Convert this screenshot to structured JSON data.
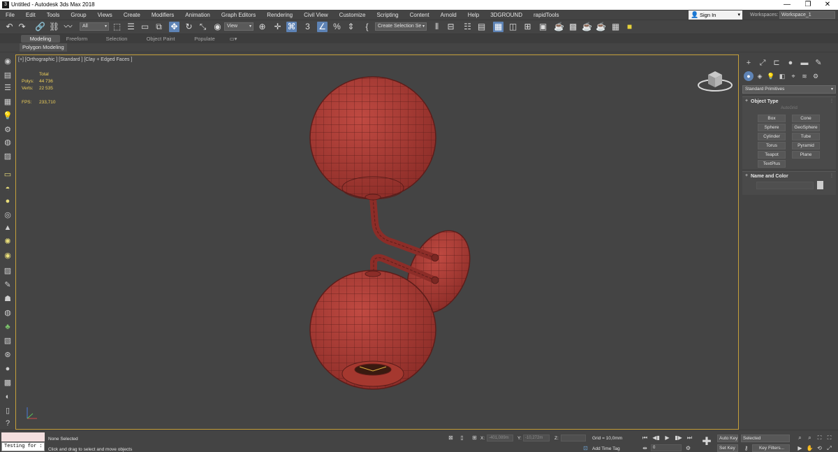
{
  "window": {
    "title": "Untitled - Autodesk 3ds Max 2018",
    "app_icon": "3ds-max-logo-icon",
    "minimize": "—",
    "restore": "❐",
    "close": "✕"
  },
  "menu": {
    "items": [
      "File",
      "Edit",
      "Tools",
      "Group",
      "Views",
      "Create",
      "Modifiers",
      "Animation",
      "Graph Editors",
      "Rendering",
      "Civil View",
      "Customize",
      "Scripting",
      "Content",
      "Arnold",
      "Help",
      "3DGROUND",
      "rapidTools"
    ],
    "sign_in": "Sign In",
    "workspaces_label": "Workspaces:",
    "workspace_value": "Workspace_1"
  },
  "toolbar": {
    "selection_filter": "All",
    "reference_coord": "View",
    "named_selection_set": "Create Selection Se"
  },
  "ribbon": {
    "tabs": [
      "Modeling",
      "Freeform",
      "Selection",
      "Object Paint",
      "Populate"
    ],
    "sub_tab": "Polygon Modeling"
  },
  "viewport": {
    "label": "[+] [Orthographic ] [Standard ] [Clay + Edged Faces ]",
    "stats": {
      "total_label": "Total",
      "polys_label": "Polys:",
      "polys_value": "44 736",
      "verts_label": "Verts:",
      "verts_value": "22 535",
      "fps_label": "FPS:",
      "fps_value": "233,710"
    },
    "model_color": "#a93a33",
    "wire_color": "#5c1d1a",
    "border_color": "#c6a03a"
  },
  "command_panel": {
    "category": "Standard Primitives",
    "object_type_title": "Object Type",
    "autogrid_label": "AutoGrid",
    "buttons": [
      "Box",
      "Cone",
      "Sphere",
      "GeoSphere",
      "Cylinder",
      "Tube",
      "Torus",
      "Pyramid",
      "Teapot",
      "Plane",
      "TextPlus"
    ],
    "name_color_title": "Name and Color",
    "rollout_plus": "+"
  },
  "status_bar": {
    "script_input": "Testing for :",
    "selection_status": "None Selected",
    "prompt": "Click and drag to select and move objects",
    "x_label": "X:",
    "x_value": "-401,089m",
    "y_label": "Y:",
    "y_value": "-10,272m",
    "z_label": "Z:",
    "z_value": "",
    "grid": "Grid = 10,0mm",
    "add_time_tag": "Add Time Tag",
    "auto_key": "Auto Key",
    "set_key": "Set Key",
    "key_mode": "Selected",
    "key_filters": "Key Filters...",
    "frame": "0"
  }
}
